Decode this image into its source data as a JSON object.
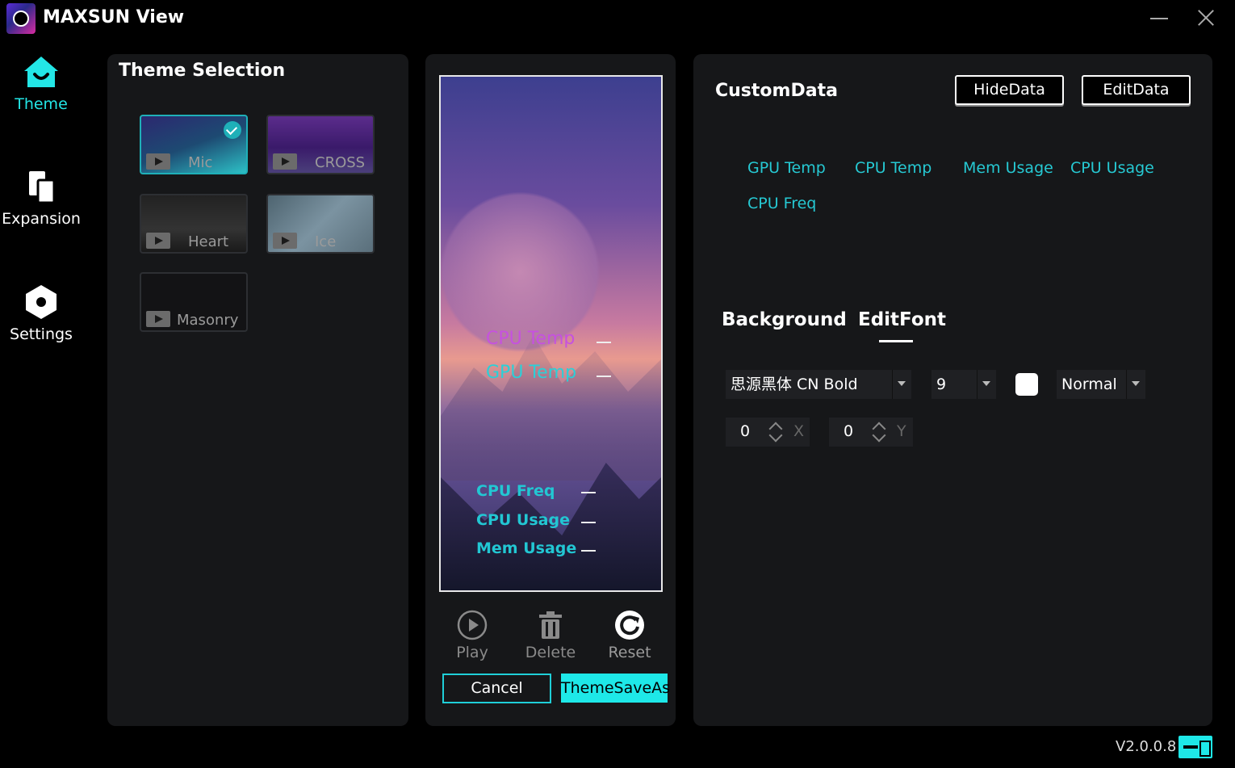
{
  "app": {
    "title": "MAXSUN View",
    "version": "V2.0.0.8",
    "accent": "#1ee8e8"
  },
  "nav": [
    {
      "label": "Theme",
      "icon": "home-icon",
      "active": true
    },
    {
      "label": "Expansion",
      "icon": "expansion-icon",
      "active": false
    },
    {
      "label": "Settings",
      "icon": "gear-icon",
      "active": false
    }
  ],
  "theme_panel": {
    "title": "Theme Selection",
    "themes": [
      {
        "label": "Mic",
        "selected": true
      },
      {
        "label": "CROSS",
        "selected": false
      },
      {
        "label": "Heart",
        "selected": false
      },
      {
        "label": "Ice",
        "selected": false
      },
      {
        "label": "Masonry",
        "selected": false
      }
    ]
  },
  "preview": {
    "labels": [
      "CPU Temp",
      "GPU Temp",
      "CPU Freq",
      "CPU Usage",
      "Mem Usage"
    ],
    "actions": {
      "play": "Play",
      "delete": "Delete",
      "reset": "Reset"
    },
    "cancel": "Cancel",
    "save_as": "ThemeSaveAs"
  },
  "custom_data": {
    "title": "CustomData",
    "hide_btn": "HideData",
    "edit_btn": "EditData",
    "items": [
      "GPU Temp",
      "CPU Temp",
      "Mem Usage",
      "CPU Usage",
      "CPU Freq"
    ],
    "tabs": {
      "background": "Background",
      "edit_font": "EditFont"
    },
    "font": {
      "family": "思源黑体 CN Bold",
      "size": "9",
      "style": "Normal",
      "color": "#ffffff"
    },
    "position": {
      "x_value": "0",
      "x_axis": "X",
      "y_value": "0",
      "y_axis": "Y"
    }
  }
}
